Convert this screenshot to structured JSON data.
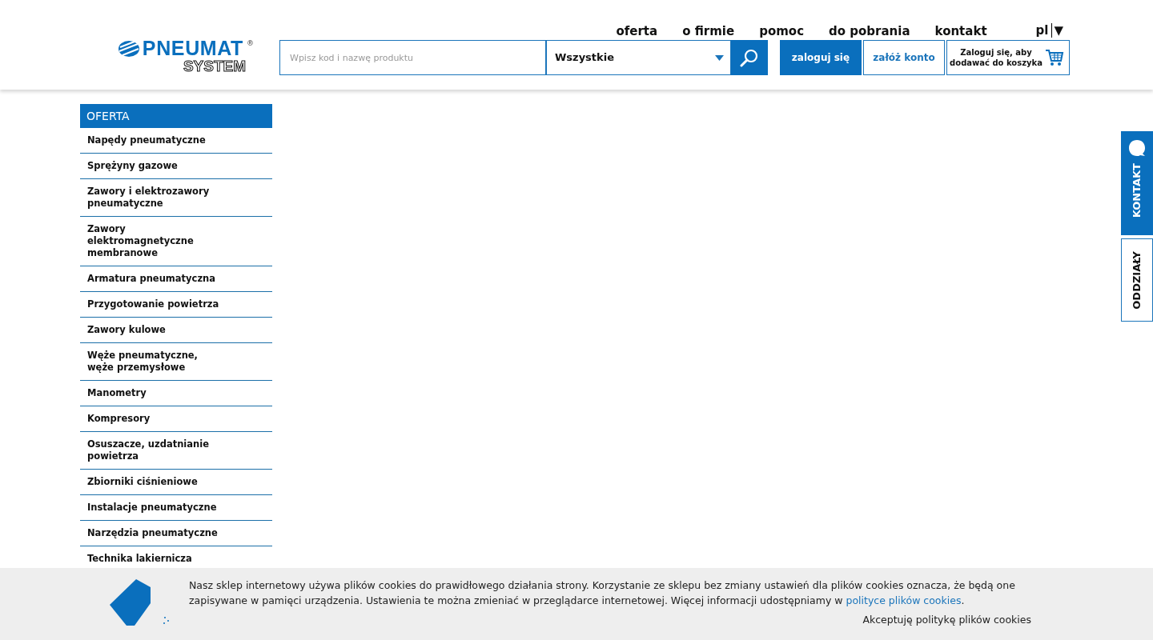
{
  "logo": {
    "brand": "PNEUMAT",
    "sub": "SYSTEM",
    "mark": "®"
  },
  "nav": [
    {
      "label": "oferta"
    },
    {
      "label": "o firmie"
    },
    {
      "label": "pomoc"
    },
    {
      "label": "do pobrania"
    },
    {
      "label": "kontakt"
    }
  ],
  "language": {
    "value": "pl",
    "arrow": "▼"
  },
  "search": {
    "placeholder": "Wpisz kod i nazwę produktu",
    "category": "Wszystkie"
  },
  "buttons": {
    "login": "zaloguj się",
    "register": "załóż konto",
    "cart": "Zaloguj się, aby dodawać do koszyka"
  },
  "sidebar": {
    "title": "OFERTA",
    "items": [
      {
        "label": "Napędy pneumatyczne"
      },
      {
        "label": "Sprężyny gazowe"
      },
      {
        "label": "Zawory i elektrozawory pneumatyczne"
      },
      {
        "label": "Zawory elektromagnetyczne membranowe"
      },
      {
        "label": "Armatura pneumatyczna"
      },
      {
        "label": "Przygotowanie powietrza"
      },
      {
        "label": "Zawory kulowe"
      },
      {
        "label": "Węże pneumatyczne, węże przemysłowe"
      },
      {
        "label": "Manometry"
      },
      {
        "label": "Kompresory"
      },
      {
        "label": "Osuszacze, uzdatnianie powietrza"
      },
      {
        "label": "Zbiorniki ciśnieniowe"
      },
      {
        "label": "Instalacje pneumatyczne"
      },
      {
        "label": "Narzędzia pneumatyczne"
      },
      {
        "label": "Technika lakiernicza"
      }
    ]
  },
  "side_tabs": [
    {
      "label": "KONTAKT",
      "kind": "filled"
    },
    {
      "label": "ODDZIAŁY",
      "kind": "outline"
    }
  ],
  "cookies": {
    "text": "Nasz sklep internetowy używa plików cookies do prawidłowego działania strony. Korzystanie ze sklepu bez zmiany ustawień dla plików cookies oznacza, że będą one zapisywane w pamięci urządzenia. Ustawienia te można zmieniać w przeglądarce internetowej. Więcej informacji udostępniamy w",
    "link": "polityce plików cookies",
    "after": ".",
    "accept": "Akceptuję politykę plików cookies"
  }
}
